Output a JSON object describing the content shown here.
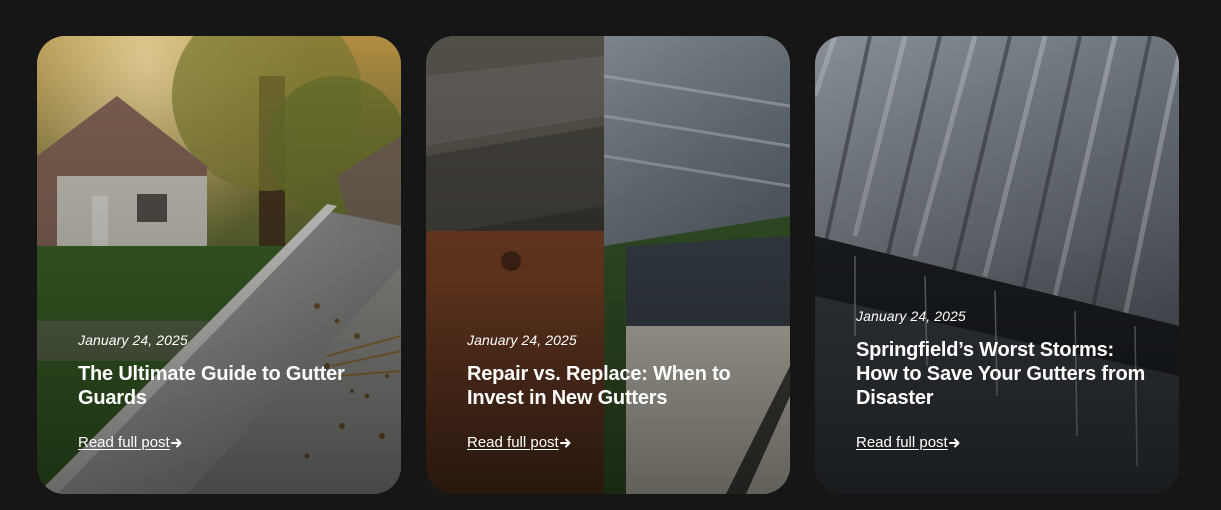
{
  "posts": [
    {
      "date": "January 24, 2025",
      "title": "The Ultimate Guide to Gutter Guards",
      "link_label": "Read full post",
      "image": "gutter-with-debris-photo"
    },
    {
      "date": "January 24, 2025",
      "title": "Repair vs. Replace: When to Invest in New Gutters",
      "link_label": "Read full post",
      "image": "old-vs-new-gutter-photo"
    },
    {
      "date": "January 24, 2025",
      "title": "Springfield’s Worst Storms: How to Save Your Gutters from Disaster",
      "link_label": "Read full post",
      "image": "metal-roof-storm-photo"
    }
  ],
  "icons": {
    "link_arrow": "arrow-right-icon"
  },
  "colors": {
    "page_background": "#161616",
    "text": "#ffffff"
  }
}
